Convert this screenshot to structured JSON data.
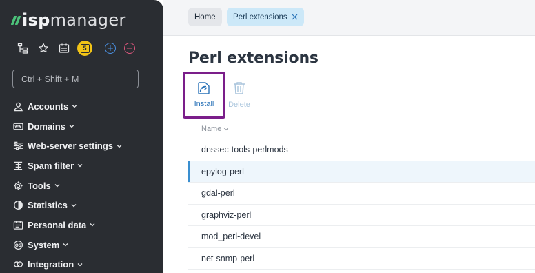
{
  "brand": {
    "part1": "isp",
    "part2": "manager"
  },
  "search": {
    "placeholder": "Ctrl + Shift + M"
  },
  "notifications": {
    "count": "5"
  },
  "nav": [
    {
      "label": "Accounts",
      "icon": "user-icon"
    },
    {
      "label": "Domains",
      "icon": "www-icon"
    },
    {
      "label": "Web-server settings",
      "icon": "sliders-icon"
    },
    {
      "label": "Spam filter",
      "icon": "filter-icon"
    },
    {
      "label": "Tools",
      "icon": "gear-icon"
    },
    {
      "label": "Statistics",
      "icon": "pie-chart-icon"
    },
    {
      "label": "Personal data",
      "icon": "id-card-icon"
    },
    {
      "label": "System",
      "icon": "os-icon"
    },
    {
      "label": "Integration",
      "icon": "link-icon"
    }
  ],
  "tabs": [
    {
      "label": "Home"
    },
    {
      "label": "Perl extensions"
    }
  ],
  "page": {
    "title": "Perl extensions"
  },
  "toolbar": {
    "install_label": "Install",
    "delete_label": "Delete"
  },
  "table": {
    "column_name": "Name",
    "rows": [
      "dnssec-tools-perlmods",
      "epylog-perl",
      "gdal-perl",
      "graphviz-perl",
      "mod_perl-devel",
      "net-snmp-perl"
    ],
    "selected_index": 1
  },
  "colors": {
    "sidebar_bg": "#2a2d32",
    "accent_blue": "#2a73b8",
    "highlight_purple": "#7b1e8a",
    "notif_yellow": "#f2c417",
    "logo_green": "#4cc27a"
  }
}
